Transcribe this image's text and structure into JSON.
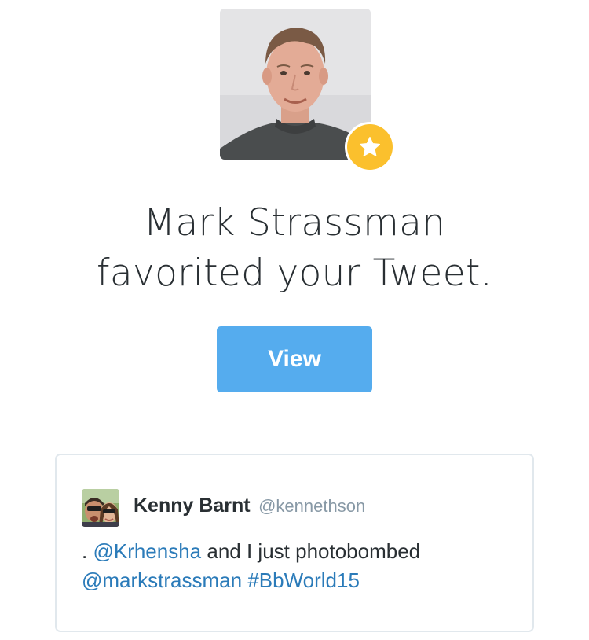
{
  "notification": {
    "avatar_icon": "user-photo",
    "badge_icon": "star-icon",
    "badge_color": "#fbc02d",
    "headline_line1": "Mark Strassman",
    "headline_line2": "favorited your Tweet.",
    "view_button_label": "View",
    "button_color": "#55acee"
  },
  "tweet": {
    "author_name": "Kenny Barnt",
    "author_handle": "@kennethson",
    "text_prefix": ". ",
    "mention_1": "@Krhensha",
    "text_middle": " and I just photobombed ",
    "mention_2": "@markstrassman",
    "text_space": " ",
    "hashtag": "#BbWorld15",
    "link_color": "#2b7bb9"
  }
}
